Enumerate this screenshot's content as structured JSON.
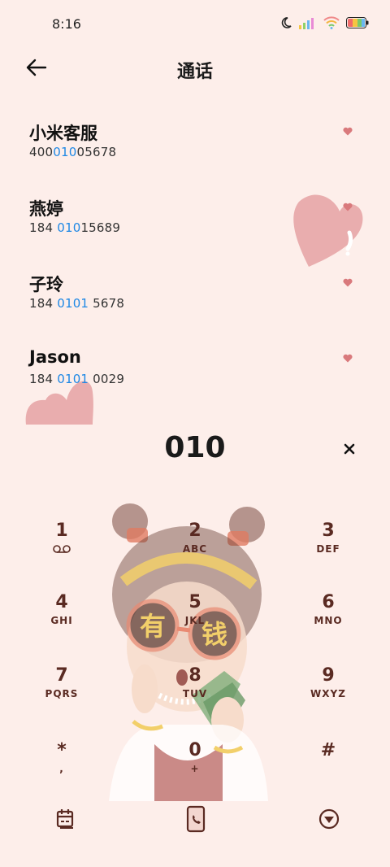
{
  "status": {
    "time": "8:16"
  },
  "header": {
    "title": "通话"
  },
  "contacts": [
    {
      "name": "小米客服",
      "num_pre": "400",
      "num_hl": "010",
      "num_post": "05678"
    },
    {
      "name": "燕婷",
      "num_pre": "184 ",
      "num_hl": "010",
      "num_post": "15689"
    },
    {
      "name": "子玲",
      "num_pre": "184 ",
      "num_hl": "0101",
      "num_post": " 5678"
    },
    {
      "name": "Jason",
      "num_pre": "184 ",
      "num_hl": "0101",
      "num_post": " 0029"
    }
  ],
  "entry": {
    "digits": "010"
  },
  "keypad": [
    {
      "digit": "1",
      "letters": ""
    },
    {
      "digit": "2",
      "letters": "ABC"
    },
    {
      "digit": "3",
      "letters": "DEF"
    },
    {
      "digit": "4",
      "letters": "GHI"
    },
    {
      "digit": "5",
      "letters": "JKL"
    },
    {
      "digit": "6",
      "letters": "MNO"
    },
    {
      "digit": "7",
      "letters": "PQRS"
    },
    {
      "digit": "8",
      "letters": "TUV"
    },
    {
      "digit": "9",
      "letters": "WXYZ"
    },
    {
      "digit": "*",
      "letters": ","
    },
    {
      "digit": "0",
      "letters": "+"
    },
    {
      "digit": "#",
      "letters": ""
    }
  ],
  "sticker": {
    "text": "有钱"
  },
  "colors": {
    "background": "#fdeeea",
    "highlight": "#1e88e5",
    "heart": "#d9797c",
    "key_text": "#5a2a22"
  }
}
